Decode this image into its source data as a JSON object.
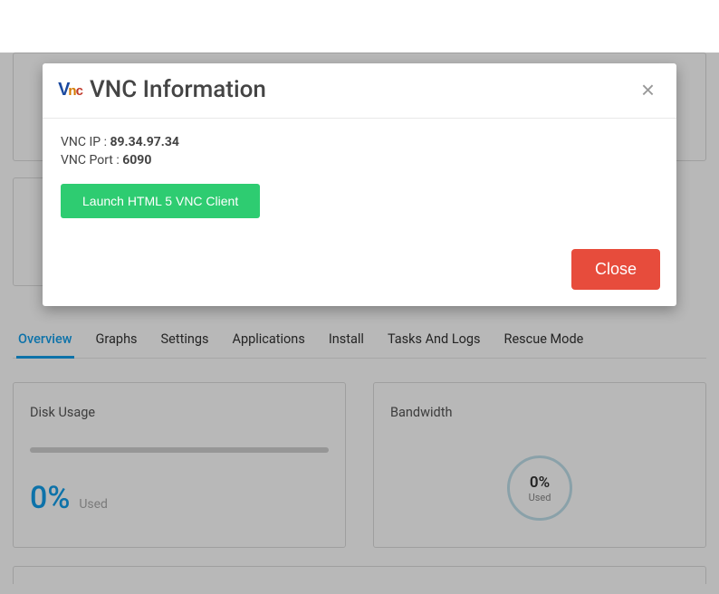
{
  "modal": {
    "title": "VNC Information",
    "ip_label": "VNC IP : ",
    "ip_value": "89.34.97.34",
    "port_label": "VNC Port : ",
    "port_value": "6090",
    "launch_label": "Launch HTML 5 VNC Client",
    "close_label": "Close"
  },
  "tabs": [
    "Overview",
    "Graphs",
    "Settings",
    "Applications",
    "Install",
    "Tasks And Logs",
    "Rescue Mode"
  ],
  "disk": {
    "title": "Disk Usage",
    "percent": "0%",
    "used_label": "Used"
  },
  "bandwidth": {
    "title": "Bandwidth",
    "percent": "0%",
    "used_label": "Used"
  }
}
